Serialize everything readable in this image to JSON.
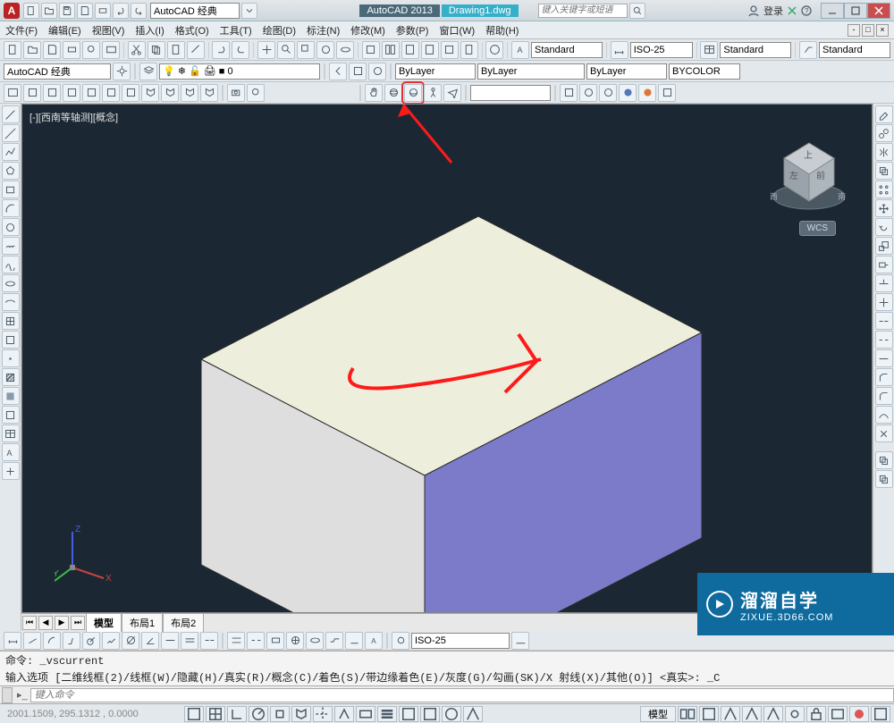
{
  "title": {
    "app": "AutoCAD 2013",
    "doc": "Drawing1.dwg",
    "workspace": "AutoCAD 经典",
    "search_placeholder": "键入关键字或短语",
    "login": "登录",
    "logo": "A"
  },
  "menu": {
    "file": "文件(F)",
    "edit": "编辑(E)",
    "view": "视图(V)",
    "insert": "插入(I)",
    "format": "格式(O)",
    "tools": "工具(T)",
    "draw": "绘图(D)",
    "dimension": "标注(N)",
    "modify": "修改(M)",
    "param": "参数(P)",
    "window": "窗口(W)",
    "help": "帮助(H)"
  },
  "styles": {
    "text": "Standard",
    "dim": "ISO-25",
    "table": "Standard",
    "mleader": "Standard"
  },
  "layer": {
    "workspace_label": "AutoCAD 经典",
    "layer": "0",
    "color": "ByLayer",
    "ltype": "ByLayer",
    "lweight": "ByLayer",
    "plot": "BYCOLOR"
  },
  "view": {
    "label": "[-][西南等轴测][概念]",
    "wcs": "WCS"
  },
  "tabs": {
    "model": "模型",
    "layout1": "布局1",
    "layout2": "布局2"
  },
  "cmd": {
    "line1": "命令: _vscurrent",
    "line2": "输入选项 [二维线框(2)/线框(W)/隐藏(H)/真实(R)/概念(C)/着色(S)/带边缘着色(E)/灰度(G)/勾画(SK)/X 射线(X)/其他(O)] <真实>: _C",
    "placeholder": "键入命令"
  },
  "status": {
    "coords": "2001.1509, 295.1312 , 0.0000",
    "model_btn": "模型"
  },
  "dim_combo": "ISO-25",
  "watermark": {
    "main": "溜溜自学",
    "sub": "ZIXUE.3D66.COM"
  }
}
